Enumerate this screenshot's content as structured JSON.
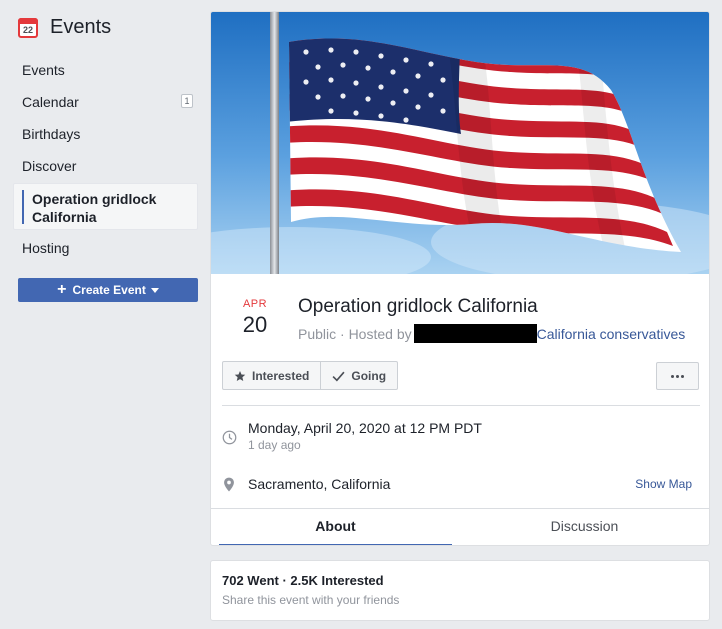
{
  "sidebar": {
    "title": "Events",
    "calendar_icon_day": "22",
    "items": {
      "events": "Events",
      "calendar": "Calendar",
      "calendar_badge": "1",
      "birthdays": "Birthdays",
      "discover": "Discover",
      "active": "Operation gridlock California",
      "hosting": "Hosting"
    },
    "create_button": "Create Event"
  },
  "event": {
    "cover_icon": "american-flag",
    "month": "APR",
    "day": "20",
    "title": "Operation gridlock California",
    "visibility": "Public · Hosted by",
    "host": "California conservatives",
    "buttons": {
      "interested": "Interested",
      "going": "Going"
    },
    "datetime": "Monday, April 20, 2020 at 12 PM PDT",
    "relative_time": "1 day ago",
    "location": "Sacramento, California",
    "show_map": "Show Map",
    "tabs": [
      "About",
      "Discussion"
    ]
  },
  "stats": {
    "summary": "702 Went · 2.5K Interested",
    "share_text": "Share this event with your friends"
  },
  "colors": {
    "accent": "#4267b2",
    "link": "#385898",
    "date_red": "#e4393c",
    "background": "#e9ebee"
  }
}
